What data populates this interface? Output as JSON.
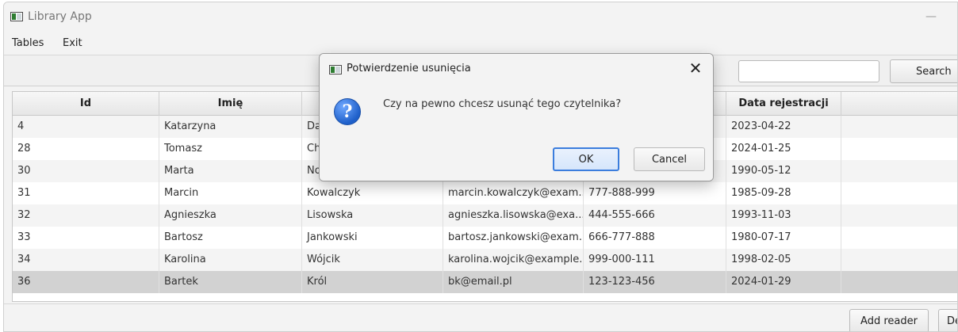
{
  "window": {
    "title": "Library App",
    "minimize_glyph": "—"
  },
  "menu": {
    "items": [
      "Tables",
      "Exit"
    ]
  },
  "toolbar": {
    "search_value": "",
    "search_button": "Search"
  },
  "table": {
    "columns": [
      "Id",
      "Imię",
      "",
      "",
      "",
      "Data rejestracji",
      ""
    ],
    "rows": [
      [
        "4",
        "Katarzyna",
        "Dąb",
        "",
        "",
        "2023-04-22",
        ""
      ],
      [
        "28",
        "Tomasz",
        "Cho",
        "",
        "",
        "2024-01-25",
        ""
      ],
      [
        "30",
        "Marta",
        "Now",
        "",
        "",
        "1990-05-12",
        ""
      ],
      [
        "31",
        "Marcin",
        "Kowalczyk",
        "marcin.kowalczyk@exam...",
        "777-888-999",
        "1985-09-28",
        ""
      ],
      [
        "32",
        "Agnieszka",
        "Lisowska",
        "agnieszka.lisowska@exa...",
        "444-555-666",
        "1993-11-03",
        ""
      ],
      [
        "33",
        "Bartosz",
        "Jankowski",
        "bartosz.jankowski@exam...",
        "666-777-888",
        "1980-07-17",
        ""
      ],
      [
        "34",
        "Karolina",
        "Wójcik",
        "karolina.wojcik@example...",
        "999-000-111",
        "1998-02-05",
        ""
      ],
      [
        "36",
        "Bartek",
        "Król",
        "bk@email.pl",
        "123-123-456",
        "2024-01-29",
        ""
      ]
    ],
    "selected_row": 7
  },
  "bottom": {
    "add_reader": "Add reader",
    "delete": "De"
  },
  "dialog": {
    "title": "Potwierdzenie usunięcia",
    "close_glyph": "✕",
    "icon_glyph": "?",
    "message": "Czy na pewno chcesz usunąć tego czytelnika?",
    "ok": "OK",
    "cancel": "Cancel"
  },
  "colors": {
    "selected_row": "#d2d2d2",
    "ok_border": "#3b7ddd",
    "question_icon": "#1e5fc9"
  }
}
